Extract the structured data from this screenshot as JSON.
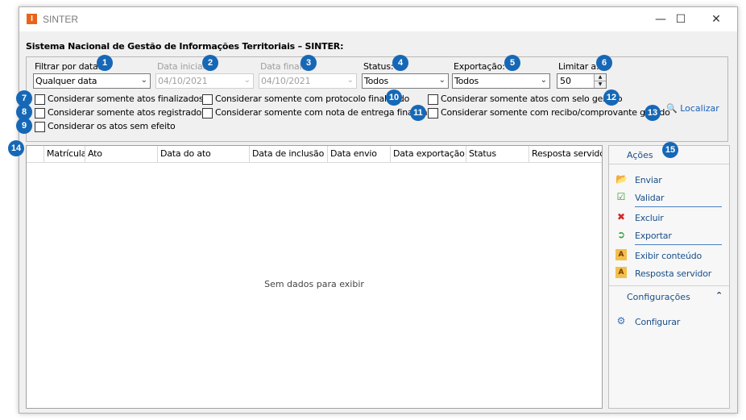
{
  "window": {
    "title": "SINTER",
    "icon_letter": "I",
    "controls": {
      "minimize": "—",
      "maximize": "☐",
      "close": "✕"
    }
  },
  "system_title": "Sistema Nacional de Gestão de Informações Territoriais – SINTER:",
  "filters": {
    "date_filter": {
      "label": "Filtrar por data:",
      "value": "Qualquer data"
    },
    "start_date": {
      "label": "Data inicial:",
      "value": "04/10/2021"
    },
    "end_date": {
      "label": "Data final:",
      "value": "04/10/2021"
    },
    "status": {
      "label": "Status:",
      "value": "Todos"
    },
    "export": {
      "label": "Exportação:",
      "value": "Todos"
    },
    "limit": {
      "label": "Limitar a:",
      "value": "50"
    }
  },
  "checkboxes": [
    "Considerar somente atos finalizados",
    "Considerar somente atos registrados",
    "Considerar os atos sem efeito",
    "Considerar somente com protocolo finalizado",
    "Considerar somente com nota de entrega finalizada",
    "Considerar somente atos com selo gerado",
    "Considerar somente com recibo/comprovante gerado"
  ],
  "search_link": "Localizar",
  "grid": {
    "columns": [
      "Matrícula",
      "Ato",
      "Data do ato",
      "Data de inclusão na",
      "Data envio",
      "Data exportação",
      "Status",
      "Resposta servidor"
    ],
    "empty_text": "Sem dados para exibir"
  },
  "actions_panel": {
    "title": "Ações",
    "items": [
      "Enviar",
      "Validar",
      "Excluir",
      "Exportar",
      "Exibir conteúdo",
      "Resposta servidor"
    ]
  },
  "config_panel": {
    "title": "Configurações",
    "items": [
      "Configurar"
    ]
  },
  "badges": [
    "1",
    "2",
    "3",
    "4",
    "5",
    "6",
    "7",
    "8",
    "9",
    "10",
    "11",
    "12",
    "13",
    "14",
    "15"
  ],
  "colors": {
    "badge": "#1668b6",
    "link": "#1a4f8a",
    "app_icon": "#e8641a"
  }
}
